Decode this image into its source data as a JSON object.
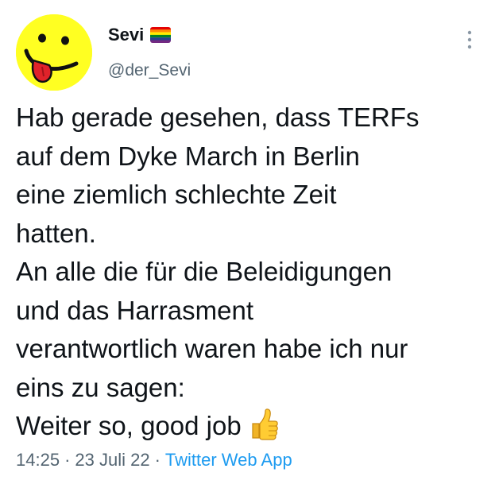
{
  "tweet": {
    "author": {
      "display_name": "Sevi",
      "handle": "@der_Sevi",
      "avatar_icon": "smiley-tongue-avatar",
      "badge_icon": "rainbow-flag-icon"
    },
    "more_icon": "vertical-dots-icon",
    "text_lines": [
      "Hab gerade gesehen, dass TERFs",
      "auf dem Dyke March in Berlin",
      "eine ziemlich schlechte Zeit",
      "hatten.",
      "An alle die für die Beleidigungen",
      "und das Harrasment",
      "verantwortlich waren habe ich nur",
      "eins zu sagen:",
      "Weiter so, good job"
    ],
    "emoji_icon": "thumbs-up-icon",
    "time": "14:25",
    "separator": "·",
    "date": "23 Juli 22",
    "source": "Twitter Web App",
    "colors": {
      "link": "#1d9bf0",
      "secondary_text": "#536471",
      "avatar_yellow": "#ffff22"
    }
  }
}
